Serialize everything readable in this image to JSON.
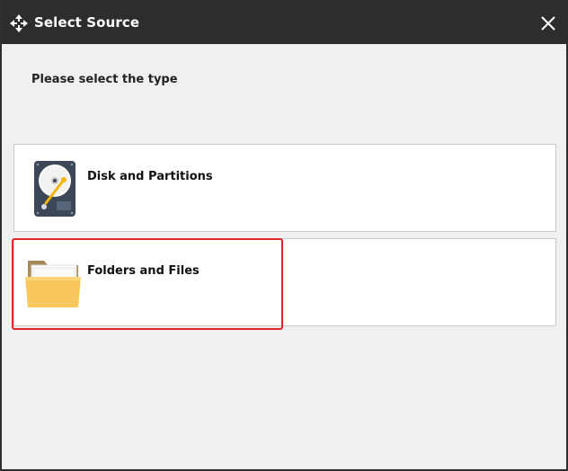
{
  "window": {
    "title": "Select Source",
    "close_icon": "close-icon",
    "app_icon": "move-arrows-icon"
  },
  "prompt": "Please select the type",
  "options": [
    {
      "label": "Disk and Partitions",
      "icon": "hard-disk-icon"
    },
    {
      "label": "Folders and Files",
      "icon": "folder-icon",
      "highlighted": true
    }
  ],
  "colors": {
    "titlebar": "#2d2d2d",
    "background": "#f0f0f0",
    "highlight": "#e0282a"
  }
}
